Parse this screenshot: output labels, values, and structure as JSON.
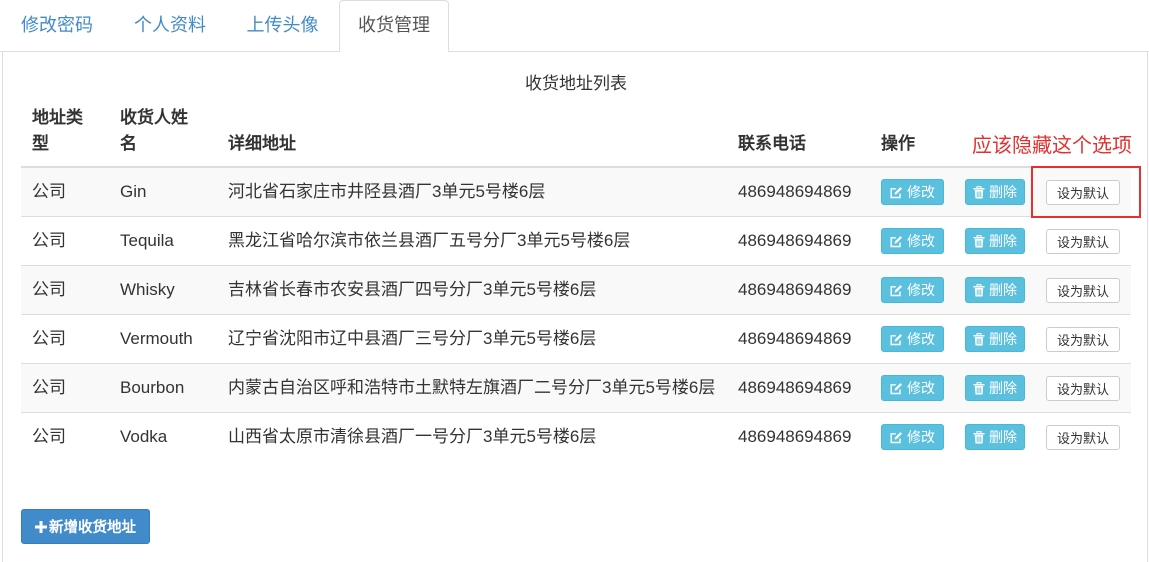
{
  "tabs": [
    {
      "label": "修改密码",
      "active": false
    },
    {
      "label": "个人资料",
      "active": false
    },
    {
      "label": "上传头像",
      "active": false
    },
    {
      "label": "收货管理",
      "active": true
    }
  ],
  "address_table": {
    "caption": "收货地址列表",
    "headers": {
      "type": "地址类型",
      "name": "收货人姓名",
      "address": "详细地址",
      "phone": "联系电话",
      "actions": "操作"
    },
    "rows": [
      {
        "type": "公司",
        "name": "Gin",
        "address": "河北省石家庄市井陉县酒厂3单元5号楼6层",
        "phone": "486948694869"
      },
      {
        "type": "公司",
        "name": "Tequila",
        "address": "黑龙江省哈尔滨市依兰县酒厂五号分厂3单元5号楼6层",
        "phone": "486948694869"
      },
      {
        "type": "公司",
        "name": "Whisky",
        "address": "吉林省长春市农安县酒厂四号分厂3单元5号楼6层",
        "phone": "486948694869"
      },
      {
        "type": "公司",
        "name": "Vermouth",
        "address": "辽宁省沈阳市辽中县酒厂三号分厂3单元5号楼6层",
        "phone": "486948694869"
      },
      {
        "type": "公司",
        "name": "Bourbon",
        "address": "内蒙古自治区呼和浩特市土默特左旗酒厂二号分厂3单元5号楼6层",
        "phone": "486948694869"
      },
      {
        "type": "公司",
        "name": "Vodka",
        "address": "山西省太原市清徐县酒厂一号分厂3单元5号楼6层",
        "phone": "486948694869"
      }
    ],
    "action_labels": {
      "edit": "修改",
      "delete": "删除",
      "set_default": "设为默认"
    }
  },
  "add_button_label": "新增收货地址",
  "annotation": {
    "text": "应该隐藏这个选项"
  },
  "icons": {
    "edit": "edit-icon",
    "delete": "trash-icon",
    "add": "plus-icon"
  },
  "colors": {
    "link": "#428bca",
    "primary": "#428bca",
    "info": "#5bc0de",
    "annotation": "#e4312f"
  }
}
